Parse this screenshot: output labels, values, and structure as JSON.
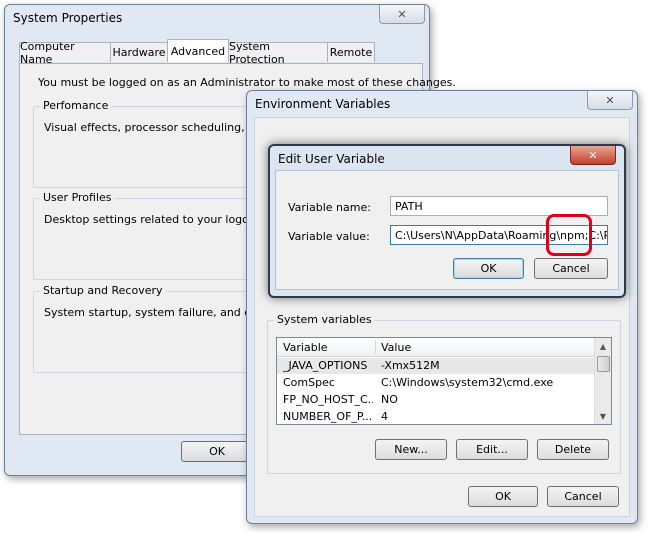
{
  "system_properties": {
    "title": "System Properties",
    "tabs": [
      "Computer Name",
      "Hardware",
      "Advanced",
      "System Protection",
      "Remote"
    ],
    "admin_notice": "You must be logged on as an Administrator to make most of these changes.",
    "performance": {
      "label": "Perfomance",
      "description": "Visual effects, processor scheduling, memo"
    },
    "user_profiles": {
      "label": "User Profiles",
      "description": "Desktop settings related to your logon"
    },
    "startup_recovery": {
      "label": "Startup and Recovery",
      "description": "System startup, system failure, and debuggi"
    },
    "ok_label": "OK"
  },
  "environment_variables": {
    "title": "Environment Variables",
    "system_variables_label": "System variables",
    "columns": [
      "Variable",
      "Value"
    ],
    "rows": [
      {
        "name": "_JAVA_OPTIONS",
        "value": "-Xmx512M"
      },
      {
        "name": "ComSpec",
        "value": "C:\\Windows\\system32\\cmd.exe"
      },
      {
        "name": "FP_NO_HOST_C...",
        "value": "NO"
      },
      {
        "name": "NUMBER_OF_P...",
        "value": "4"
      }
    ],
    "new_label": "New...",
    "edit_label": "Edit...",
    "delete_label": "Delete",
    "ok_label": "OK",
    "cancel_label": "Cancel"
  },
  "edit_user_variable": {
    "title": "Edit User Variable",
    "name_label": "Variable name:",
    "name_value": "PATH",
    "value_label": "Variable value:",
    "value_value": "C:\\Users\\N\\AppData\\Roaming\\npm;C:\\Prog",
    "ok_label": "OK",
    "cancel_label": "Cancel"
  },
  "colors": {
    "highlight": "#e0001a",
    "window_frame": "#dfe8f3",
    "panel": "#f0f0f0"
  }
}
